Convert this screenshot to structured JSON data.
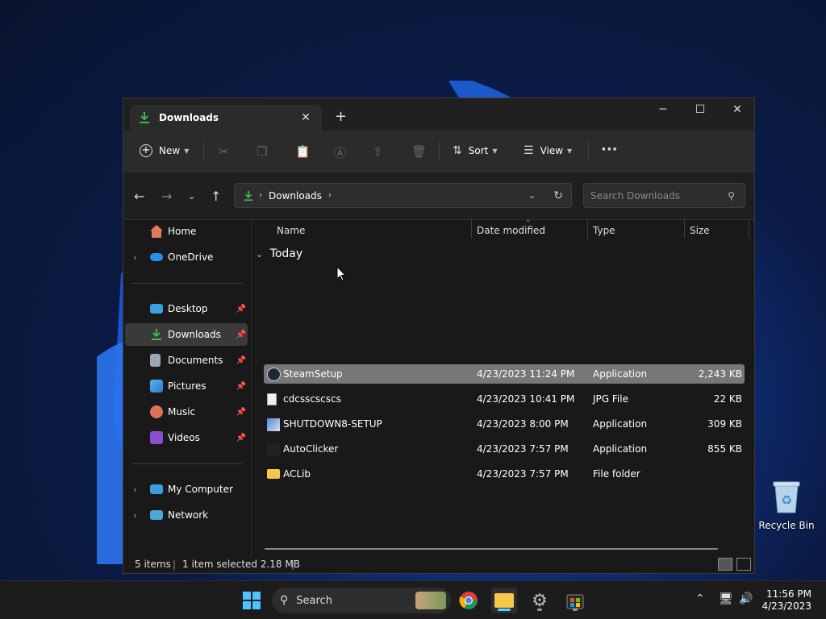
{
  "window": {
    "tab_title": "Downloads",
    "tab_close": "✕",
    "new_tab": "+",
    "minimize": "─",
    "maximize": "☐",
    "close": "✕"
  },
  "toolbar": {
    "new_label": "New",
    "sort_label": "Sort",
    "view_label": "View",
    "more": "···"
  },
  "address": {
    "location": "Downloads",
    "search_placeholder": "Search Downloads"
  },
  "sidebar": {
    "items": [
      {
        "label": "Home",
        "icon": "home-icon"
      },
      {
        "label": "OneDrive",
        "icon": "cloud-icon"
      },
      {
        "label": "Desktop",
        "icon": "desktop-icon"
      },
      {
        "label": "Downloads",
        "icon": "download-icon"
      },
      {
        "label": "Documents",
        "icon": "document-icon"
      },
      {
        "label": "Pictures",
        "icon": "picture-icon"
      },
      {
        "label": "Music",
        "icon": "music-icon"
      },
      {
        "label": "Videos",
        "icon": "video-icon"
      },
      {
        "label": "My Computer",
        "icon": "computer-icon"
      },
      {
        "label": "Network",
        "icon": "network-icon"
      }
    ]
  },
  "columns": {
    "name": "Name",
    "date": "Date modified",
    "type": "Type",
    "size": "Size"
  },
  "group_label": "Today",
  "files": [
    {
      "name": "SteamSetup",
      "date": "4/23/2023 11:24 PM",
      "type": "Application",
      "size": "2,243 KB",
      "selected": true
    },
    {
      "name": "cdcsscscscs",
      "date": "4/23/2023 10:41 PM",
      "type": "JPG File",
      "size": "22 KB"
    },
    {
      "name": "SHUTDOWN8-SETUP",
      "date": "4/23/2023 8:00 PM",
      "type": "Application",
      "size": "309 KB"
    },
    {
      "name": "AutoClicker",
      "date": "4/23/2023 7:57 PM",
      "type": "Application",
      "size": "855 KB"
    },
    {
      "name": "ACLib",
      "date": "4/23/2023 7:57 PM",
      "type": "File folder",
      "size": ""
    }
  ],
  "status": {
    "items": "5 items",
    "selection": "1 item selected  2.18 MB"
  },
  "desktop": {
    "recycle_bin": "Recycle Bin"
  },
  "taskbar": {
    "search_label": "Search",
    "time": "11:56 PM",
    "date": "4/23/2023"
  },
  "colors": {
    "accent": "#60cdff",
    "selection": "#777777",
    "download_green": "#3fb950"
  }
}
